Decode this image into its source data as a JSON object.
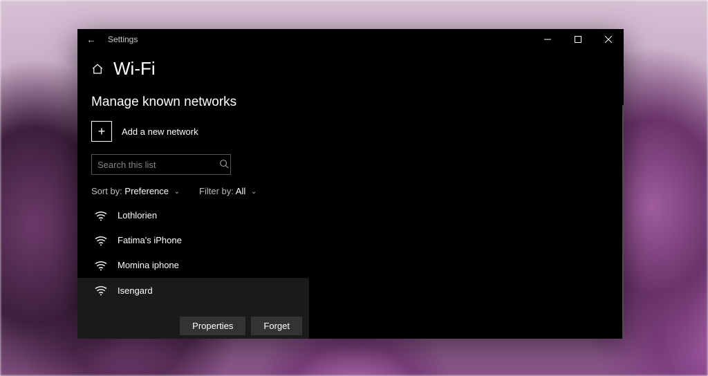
{
  "titlebar": {
    "back_icon": "←",
    "title": "Settings"
  },
  "header": {
    "page_title": "Wi-Fi"
  },
  "section": {
    "heading": "Manage known networks",
    "add_label": "Add a new network"
  },
  "search": {
    "placeholder": "Search this list"
  },
  "sort": {
    "label": "Sort by:",
    "value": "Preference"
  },
  "filter": {
    "label": "Filter by:",
    "value": "All"
  },
  "networks": {
    "items": [
      {
        "name": "Lothlorien"
      },
      {
        "name": "Fatima's iPhone"
      },
      {
        "name": "Momina iphone"
      },
      {
        "name": "Isengard"
      }
    ]
  },
  "buttons": {
    "properties": "Properties",
    "forget": "Forget"
  }
}
